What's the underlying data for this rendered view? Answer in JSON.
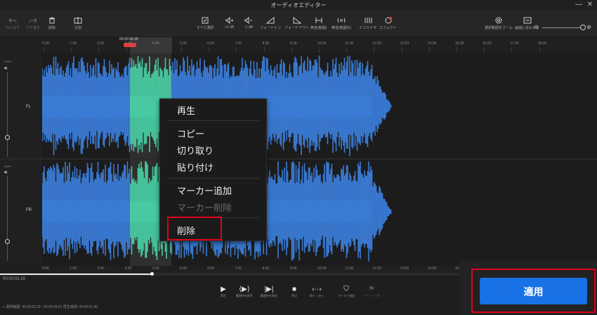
{
  "window": {
    "title": "オーディオエディター",
    "min": "—",
    "close": "✕"
  },
  "toolbar": {
    "undo": "元に戻す",
    "redo": "やり直す",
    "delete": "削除",
    "split": "分割",
    "select_all": "すべて選択",
    "vol_up": "+1 dB",
    "vol_down": "-1 dB",
    "fade_in": "フェードイン",
    "fade_out": "フェードアウト",
    "silence": "無音(範囲)",
    "noise": "無音(範囲外)",
    "equalizer": "イコライザ",
    "effect": "エフェクト",
    "zoom_selection": "選択範囲をズーム",
    "fit_screen": "画面に合わせる",
    "zoom_minus": "⊖",
    "zoom_plus": "⊕"
  },
  "ruler": {
    "ticks": [
      "0.00",
      "1.00",
      "2.00",
      "3.00",
      "4.00",
      "5.00",
      "6.00",
      "7.00",
      "8.00",
      "9.00",
      "10.00",
      "11.00",
      "12.00",
      "13.00",
      "14.00",
      "15.00",
      "16.00",
      "17.00",
      "18.00"
    ],
    "playhead": "00:00:03.18",
    "bottom_ticks": [
      "0.00",
      "1.00",
      "2.00",
      "3.00",
      "4.00",
      "5.00",
      "6.00",
      "7.00",
      "8.00",
      "9.00",
      "10.00",
      "11.00",
      "12.00",
      "13.00",
      "14.00",
      "15.00",
      "16.00",
      "17.00",
      "18.00"
    ]
  },
  "channels": [
    {
      "label": "FL",
      "pct": "100%"
    },
    {
      "label": "FR",
      "pct": "100%"
    }
  ],
  "context_menu": {
    "play": "再生",
    "copy": "コピー",
    "cut": "切り取り",
    "paste": "貼り付け",
    "add_marker": "マーカー追加",
    "remove_marker": "マーカー削除",
    "delete": "削除"
  },
  "playback": {
    "current_time": "00:00:03.18",
    "progress": 0.254,
    "play": "再生",
    "play_range": "範囲内を再生",
    "play_outside": "範囲外を再生",
    "stop": "停止",
    "prev_next": "前へ・次へ",
    "add_marker": "マーカー追加",
    "marker_list": "マーカー一覧",
    "status_prefix": "選択範囲: 00:00:03.18 - 00:00:04.67  再生時間: 00:00:01.49"
  },
  "apply": {
    "label": "適用"
  },
  "colors": {
    "wave": "#3a7bd5",
    "selection": "#48c9a0",
    "accent": "#1971e6",
    "highlight": "#e0001b"
  }
}
